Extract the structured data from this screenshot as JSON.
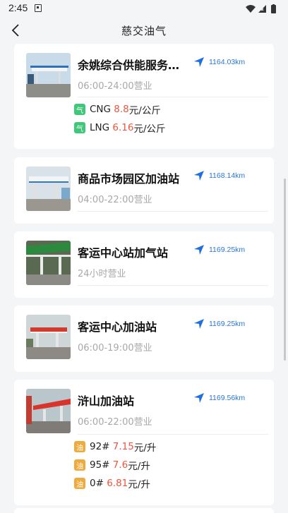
{
  "status_bar": {
    "time": "2:45"
  },
  "header": {
    "title": "慈交油气"
  },
  "stations": [
    {
      "name": "余姚综合供能服务…",
      "distance": "1164.03km",
      "hours": "06:00-24:00营业",
      "fuels": [
        {
          "type": "gas",
          "badge": "气",
          "grade": "CNG",
          "price": "8.8",
          "unit": "元/公斤"
        },
        {
          "type": "gas",
          "badge": "气",
          "grade": "LNG",
          "price": "6.16",
          "unit": "元/公斤"
        }
      ]
    },
    {
      "name": "商品市场园区加油站",
      "distance": "1168.14km",
      "hours": "04:00-22:00营业",
      "fuels": []
    },
    {
      "name": "客运中心站加气站",
      "distance": "1169.25km",
      "hours": "24小时营业",
      "fuels": []
    },
    {
      "name": "客运中心加油站",
      "distance": "1169.25km",
      "hours": "06:00-19:00营业",
      "fuels": []
    },
    {
      "name": "浒山加油站",
      "distance": "1169.56km",
      "hours": "06:00-22:00营业",
      "fuels": [
        {
          "type": "oil",
          "badge": "油",
          "grade": "92#",
          "price": "7.15",
          "unit": "元/升"
        },
        {
          "type": "oil",
          "badge": "油",
          "grade": "95#",
          "price": "7.6",
          "unit": "元/升"
        },
        {
          "type": "oil",
          "badge": "油",
          "grade": "0#",
          "price": "6.81",
          "unit": "元/升"
        }
      ]
    }
  ]
}
